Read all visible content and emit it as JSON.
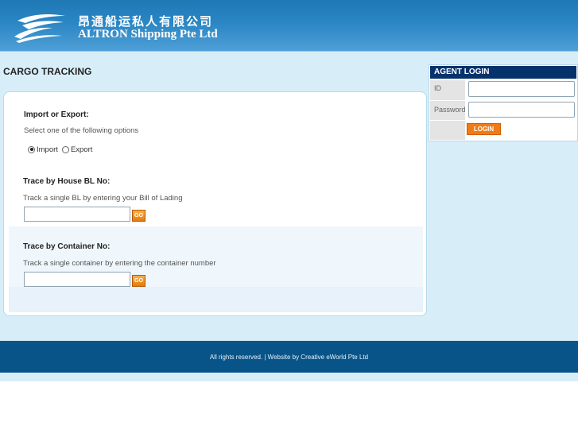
{
  "header": {
    "company_cn": "昂通船运私人有限公司",
    "company_en": "ALTRON Shipping Pte Ltd",
    "logo_icon": "ship-waves-logo"
  },
  "page": {
    "title": "CARGO TRACKING"
  },
  "tracking": {
    "import_export": {
      "heading": "Import or Export:",
      "description": "Select one of the following options",
      "options": [
        {
          "label": "Import",
          "checked": true
        },
        {
          "label": "Export",
          "checked": false
        }
      ]
    },
    "house_bl": {
      "heading": "Trace by House BL No:",
      "description": "Track a single BL by entering your Bill of Lading",
      "input_value": "",
      "go_label": "GO"
    },
    "container": {
      "heading": "Trace by Container No:",
      "description": "Track a single container by entering the container number",
      "input_value": "",
      "go_label": "GO"
    }
  },
  "agent_login": {
    "title": "AGENT LOGIN",
    "id_label": "ID",
    "password_label": "Password",
    "id_value": "",
    "password_value": "",
    "login_label": "LOGIN"
  },
  "footer": {
    "text": "All rights reserved. | Website by Creative eWorld Pte Ltd"
  },
  "colors": {
    "header_blue": "#2a86c4",
    "content_bg": "#d7eef9",
    "login_title_bg": "#06326c",
    "accent_orange": "#f07a14",
    "footer_bg": "#085489"
  }
}
